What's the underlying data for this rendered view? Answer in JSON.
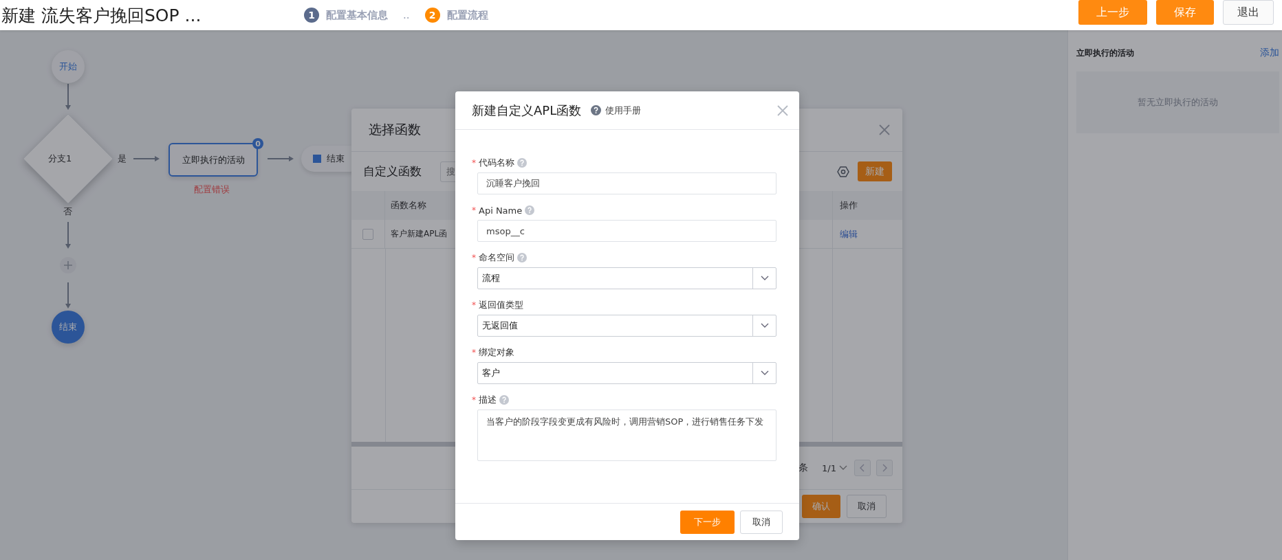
{
  "header": {
    "title": "新建 流失客户挽回SOP ...",
    "steps": [
      {
        "number": "1",
        "label": "配置基本信息",
        "selected": false
      },
      {
        "number": "2",
        "label": "配置流程",
        "selected": true
      }
    ],
    "step_separator": "..",
    "buttons": [
      {
        "label": "上一步",
        "kind": "primary"
      },
      {
        "label": "保存",
        "kind": "primary"
      },
      {
        "label": "退出",
        "kind": "default"
      }
    ]
  },
  "flow": {
    "start": "开始",
    "branch": {
      "label": "分支1",
      "yes": "是",
      "no": "否"
    },
    "activity": {
      "label": "立即执行的活动",
      "badge": "0",
      "error": "配置错误"
    },
    "yes_end": "结束",
    "no_end": "结束"
  },
  "side_panel": {
    "title": "立即执行的活动",
    "action": "添加",
    "empty_text": "暂无立即执行的活动"
  },
  "function_dialog": {
    "title": "选择函数",
    "section": "自定义函数",
    "search_placeholder": "搜",
    "new_button": "新建",
    "columns": [
      "函数名称",
      "操作"
    ],
    "rows": [
      {
        "name": "客户新建APL函",
        "action": "编辑",
        "checked": false
      }
    ],
    "pagination": {
      "count_suffix": "条",
      "page": "1/1"
    },
    "buttons": [
      {
        "label": "确认",
        "kind": "primary"
      },
      {
        "label": "取消",
        "kind": "default"
      }
    ]
  },
  "modal": {
    "title": "新建自定义APL函数",
    "help": "使用手册",
    "fields": [
      {
        "label": "代码名称",
        "kind": "input",
        "required_mark": "*",
        "help": true,
        "value": "沉睡客户挽回"
      },
      {
        "label": "Api Name",
        "kind": "input",
        "required_mark": "*",
        "help": true,
        "value": "msop__c"
      },
      {
        "label": "命名空间",
        "kind": "select",
        "required_mark": "*",
        "help": true,
        "value": "流程"
      },
      {
        "label": "返回值类型",
        "kind": "select",
        "required_mark": "*",
        "help": false,
        "value": "无返回值"
      },
      {
        "label": "绑定对象",
        "kind": "select",
        "required_mark": "*",
        "help": false,
        "value": "客户"
      },
      {
        "label": "描述",
        "kind": "textarea",
        "required_mark": "*",
        "help": true,
        "value": "当客户的阶段字段变更成有风险时，调用营销SOP，进行销售任务下发"
      }
    ],
    "buttons": [
      {
        "label": "下一步",
        "kind": "primary"
      },
      {
        "label": "取消",
        "kind": "default"
      }
    ]
  }
}
